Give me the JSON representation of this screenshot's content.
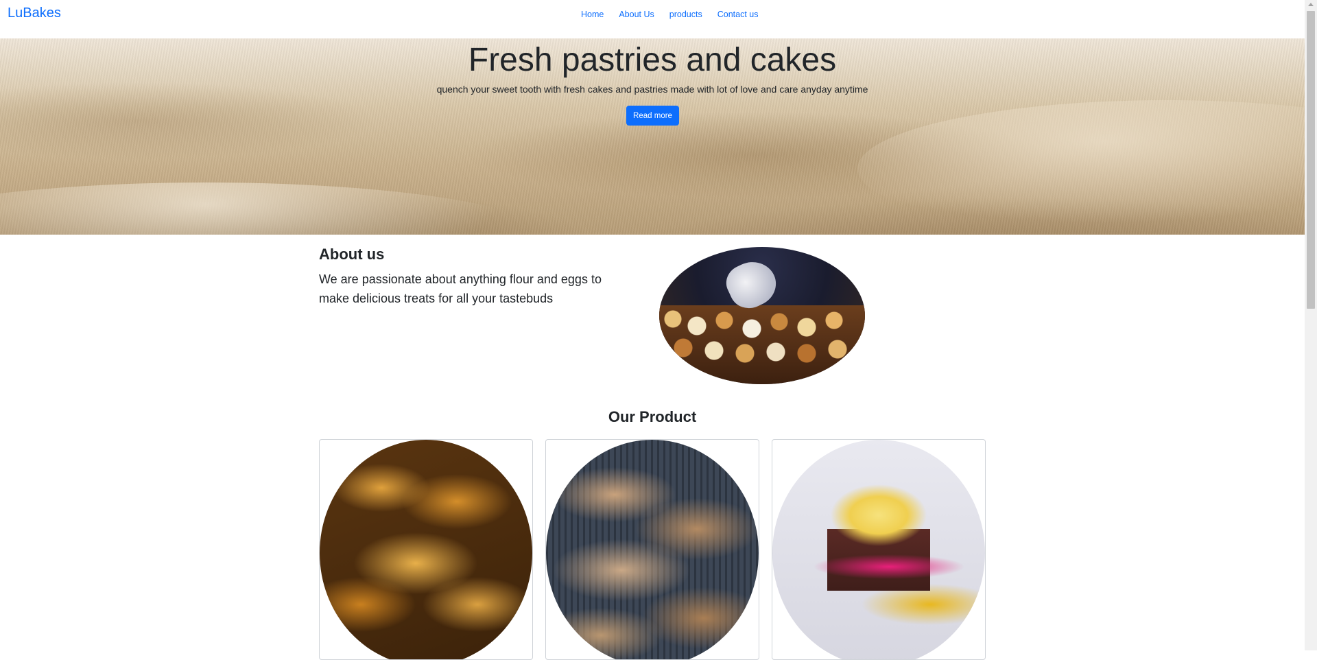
{
  "brand": "LuBakes",
  "nav": [
    "Home",
    "About Us",
    "products",
    "Contact us"
  ],
  "hero": {
    "title": "Fresh pastries and cakes",
    "subtitle": "quench your sweet tooth with fresh cakes and pastries made with lot of love and care anyday anytime",
    "button": "Read more"
  },
  "about": {
    "title": "About us",
    "text": "We are passionate about anything flour and eggs to make delicious treats for all your tastebuds"
  },
  "products": {
    "title": "Our Product"
  },
  "colors": {
    "link": "#0d6efd",
    "button": "#0d6efd",
    "text": "#212529"
  }
}
